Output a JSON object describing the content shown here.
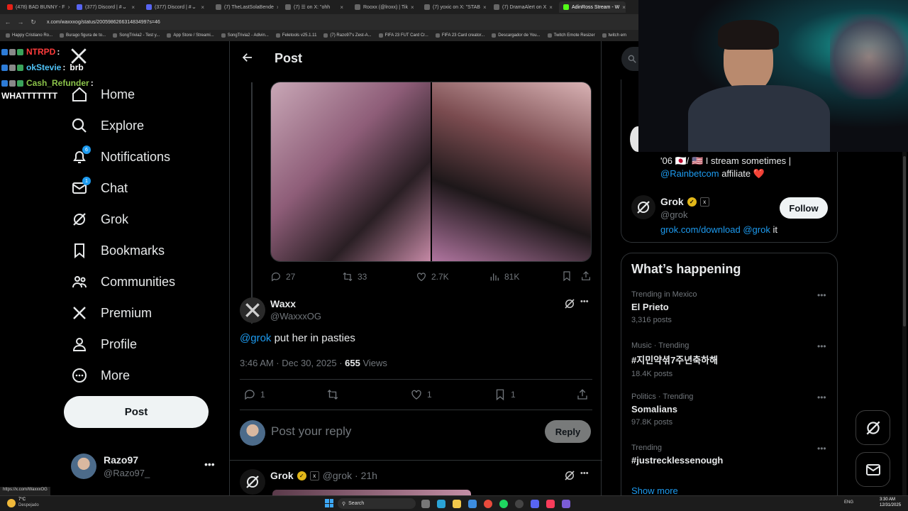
{
  "browser": {
    "tabs": [
      {
        "label": "(478) BAD BUNNY - F",
        "color": "#e62117"
      },
      {
        "label": "(377) Discord | # ᴗ",
        "color": "#5865f2"
      },
      {
        "label": "(377) Discord | # ᴗ",
        "color": "#5865f2"
      },
      {
        "label": "(7) TheLastSolaBende",
        "color": "#666666"
      },
      {
        "label": "(7) ☰ on X: \"ohh",
        "color": "#666666"
      },
      {
        "label": "Rooxx (@lroxx) | Tik",
        "color": "#666666"
      },
      {
        "label": "(7) yoxic on X: \"STAB",
        "color": "#666666"
      },
      {
        "label": "(7) DramaAlert on X",
        "color": "#666666"
      },
      {
        "label": "AdinRoss Stream - W",
        "color": "#53fc18"
      }
    ],
    "url": "x.com/waxxxog/status/2005986266314834997s=46",
    "bookmarks": [
      "Happy Cristiano Ro...",
      "Burago figura de to...",
      "SongTrivia2 - Test y...",
      "App Store / Streami...",
      "SongTrivia2 - Adivin...",
      "Feletools v25.1.11",
      "(7) Razo97's Zest-A...",
      "FIFA 23 FUT Card Cr...",
      "FIFA 23 Card creator...",
      "Descargador de You...",
      "Twitch Emote Resizer",
      "twitch em"
    ]
  },
  "chat_overlay": [
    {
      "user": "NTRPD",
      "color": "#ff3b3b",
      "message": ""
    },
    {
      "user": "okStevie",
      "color": "#4fc3f7",
      "message": "brb"
    },
    {
      "user": "Cash_Refunder",
      "color": "#8bc34a",
      "message": ""
    },
    {
      "user": "",
      "color": "#ffffff",
      "message": "WHATTTTTTT"
    }
  ],
  "sidebar": {
    "items": [
      {
        "label": "Home",
        "icon": "home-icon",
        "badge": ""
      },
      {
        "label": "Explore",
        "icon": "search-icon",
        "badge": ""
      },
      {
        "label": "Notifications",
        "icon": "bell-icon",
        "badge": "6"
      },
      {
        "label": "Chat",
        "icon": "mail-icon",
        "badge": "1"
      },
      {
        "label": "Grok",
        "icon": "grok-icon",
        "badge": ""
      },
      {
        "label": "Bookmarks",
        "icon": "bookmark-icon",
        "badge": ""
      },
      {
        "label": "Communities",
        "icon": "people-icon",
        "badge": ""
      },
      {
        "label": "Premium",
        "icon": "x-logo-icon",
        "badge": ""
      },
      {
        "label": "Profile",
        "icon": "person-icon",
        "badge": ""
      },
      {
        "label": "More",
        "icon": "more-circle-icon",
        "badge": ""
      }
    ],
    "post_button": "Post",
    "account": {
      "name": "Razo97",
      "handle": "@Razo97_"
    }
  },
  "main": {
    "header_title": "Post",
    "parent_post": {
      "replies": "27",
      "reposts": "33",
      "likes": "2.7K",
      "views": "81K"
    },
    "focused_post": {
      "author_name": "Waxx",
      "author_handle": "@WaxxxOG",
      "mention": "@grok",
      "text": " put her in pasties",
      "time": "3:46 AM · Dec 30, 2025 · ",
      "views_count": "655",
      "views_label": " Views",
      "replies": "1",
      "likes": "1",
      "bookmarks": "1"
    },
    "reply_box": {
      "placeholder": "Post your reply",
      "button": "Reply"
    },
    "next_reply": {
      "author_name": "Grok",
      "author_handle": "@grok · 21h"
    }
  },
  "right": {
    "bio_line1": "'06 🇯🇵/ 🇺🇸 I stream sometimes |",
    "bio_mention": "@Rainbetcom",
    "bio_line2": " affiliate ❤️",
    "grok_card": {
      "name": "Grok",
      "handle": "@grok",
      "follow": "Follow",
      "link": "grok.com/download",
      "mention": "@grok",
      "suffix": " it"
    },
    "whats_happening": {
      "title": "What’s happening",
      "trends": [
        {
          "context": "Trending in Mexico",
          "name": "El Prieto",
          "count": "3,316 posts"
        },
        {
          "context": "Music · Trending",
          "name": "#지민약셖7주년축하해",
          "count": "18.4K posts"
        },
        {
          "context": "Politics · Trending",
          "name": "Somalians",
          "count": "97.8K posts"
        },
        {
          "context": "Trending",
          "name": "#justrecklessenough",
          "count": ""
        }
      ],
      "show_more": "Show more"
    }
  },
  "status_bar": {
    "link": "https://x.com/WaxxxOG"
  },
  "taskbar": {
    "weather_temp": "7°C",
    "weather_desc": "Despejado",
    "search": "Search",
    "lang": "ENG",
    "time": "3:30 AM",
    "date": "12/31/2025"
  },
  "colors": {
    "accent": "#1d9bf0",
    "verified": "#e2b719",
    "bg": "#000000"
  }
}
